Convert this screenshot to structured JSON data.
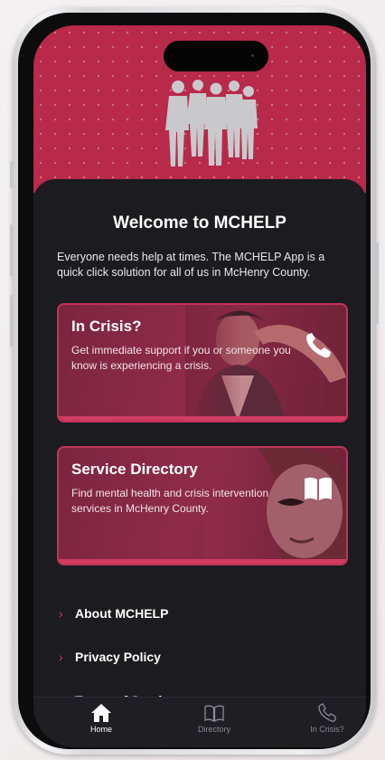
{
  "header": {
    "title": "Welcome to MCHELP",
    "intro": "Everyone needs help at times. The MCHELP App is a quick click solution for all of us in McHenry County."
  },
  "cards": {
    "crisis": {
      "title": "In Crisis?",
      "description": "Get immediate support if you or someone you know is experiencing a crisis.",
      "icon": "phone-icon"
    },
    "directory": {
      "title": "Service Directory",
      "description": "Find mental health and crisis intervention services in McHenry County.",
      "icon": "book-icon"
    }
  },
  "links": [
    {
      "label": "About MCHELP"
    },
    {
      "label": "Privacy Policy"
    },
    {
      "label": "Terms of Service"
    }
  ],
  "tabs": [
    {
      "label": "Home",
      "icon": "home-icon",
      "active": true
    },
    {
      "label": "Directory",
      "icon": "book-icon",
      "active": false
    },
    {
      "label": "In Crisis?",
      "icon": "phone-icon",
      "active": false
    }
  ],
  "colors": {
    "brand": "#b8294a",
    "accent": "#d63a5e",
    "background": "#1c1b20"
  }
}
